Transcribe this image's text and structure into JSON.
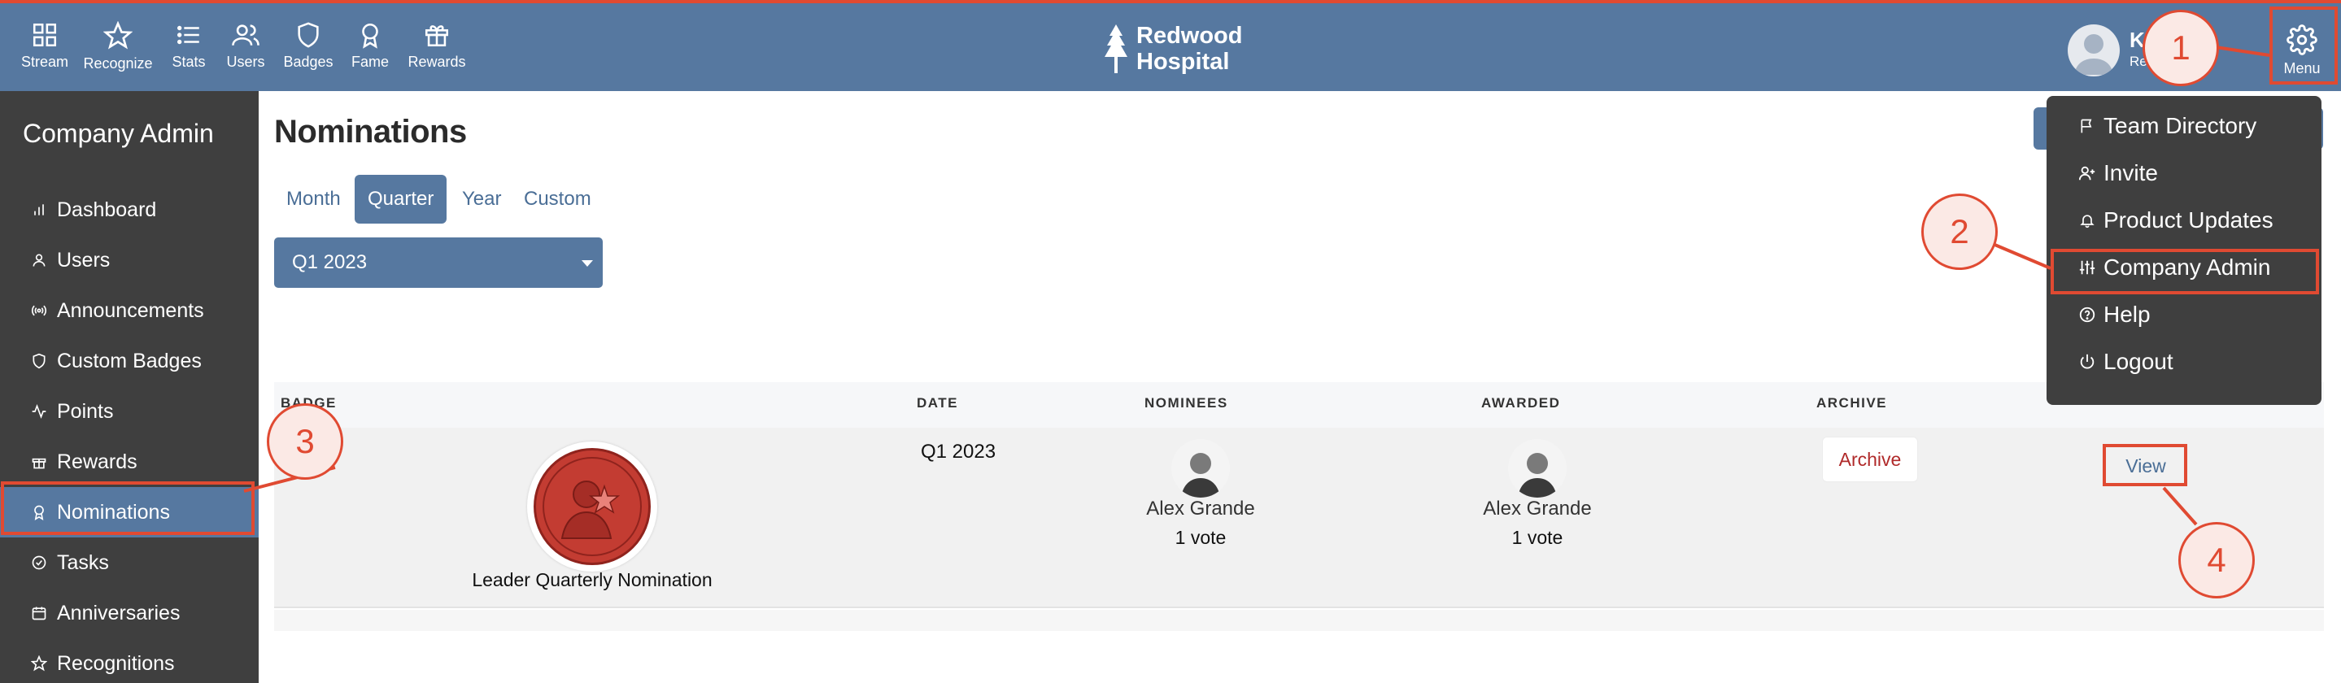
{
  "topnav": {
    "items": [
      {
        "label": "Stream",
        "icon": "grid-icon"
      },
      {
        "label": "Recognize",
        "icon": "star-icon"
      },
      {
        "label": "Stats",
        "icon": "list-icon"
      },
      {
        "label": "Users",
        "icon": "users-icon"
      },
      {
        "label": "Badges",
        "icon": "shield-icon"
      },
      {
        "label": "Fame",
        "icon": "award-icon"
      },
      {
        "label": "Rewards",
        "icon": "gift-icon"
      }
    ],
    "brand": {
      "line1": "Redwood",
      "line2": "Hospital"
    },
    "user": {
      "name": "Ka        nt",
      "role": "Re"
    },
    "menu_label": "Menu"
  },
  "sidebar": {
    "title": "Company Admin",
    "items": [
      {
        "label": "Dashboard",
        "icon": "bar-chart-icon"
      },
      {
        "label": "Users",
        "icon": "user-icon"
      },
      {
        "label": "Announcements",
        "icon": "broadcast-icon"
      },
      {
        "label": "Custom Badges",
        "icon": "shield-icon"
      },
      {
        "label": "Points",
        "icon": "activity-icon"
      },
      {
        "label": "Rewards",
        "icon": "gift-icon"
      },
      {
        "label": "Nominations",
        "icon": "award-icon",
        "active": true
      },
      {
        "label": "Tasks",
        "icon": "check-circle-icon"
      },
      {
        "label": "Anniversaries",
        "icon": "calendar-icon"
      },
      {
        "label": "Recognitions",
        "icon": "star-icon"
      }
    ]
  },
  "main": {
    "title": "Nominations",
    "tabs": [
      {
        "label": "Month"
      },
      {
        "label": "Quarter",
        "active": true
      },
      {
        "label": "Year"
      },
      {
        "label": "Custom"
      }
    ],
    "period_select": {
      "value": "Q1 2023"
    },
    "table": {
      "headers": [
        "BADGE",
        "DATE",
        "NOMINEES",
        "AWARDED",
        "ARCHIVE"
      ],
      "rows": [
        {
          "badge_name": "Leader Quarterly Nomination",
          "date": "Q1 2023",
          "nominee": {
            "name": "Alex Grande",
            "votes": "1 vote"
          },
          "awarded": {
            "name": "Alex Grande",
            "votes": "1 vote"
          },
          "archive_label": "Archive",
          "view_label": "View"
        }
      ]
    }
  },
  "dropdown_menu": {
    "items": [
      {
        "label": "Team Directory",
        "icon": "flag-icon"
      },
      {
        "label": "Invite",
        "icon": "user-plus-icon"
      },
      {
        "label": "Product Updates",
        "icon": "bell-icon"
      },
      {
        "label": "Company Admin",
        "icon": "sliders-icon"
      },
      {
        "label": "Help",
        "icon": "help-circle-icon"
      },
      {
        "label": "Logout",
        "icon": "power-icon"
      }
    ]
  },
  "annotations": {
    "callouts": [
      "1",
      "2",
      "3",
      "4"
    ],
    "color": "#e04a32"
  },
  "colors": {
    "topbar": "#5678a0",
    "sidebar": "#3f3f3f",
    "accent": "#5678a0",
    "archive_text": "#b02a2a",
    "badge_red": "#c33c32"
  }
}
